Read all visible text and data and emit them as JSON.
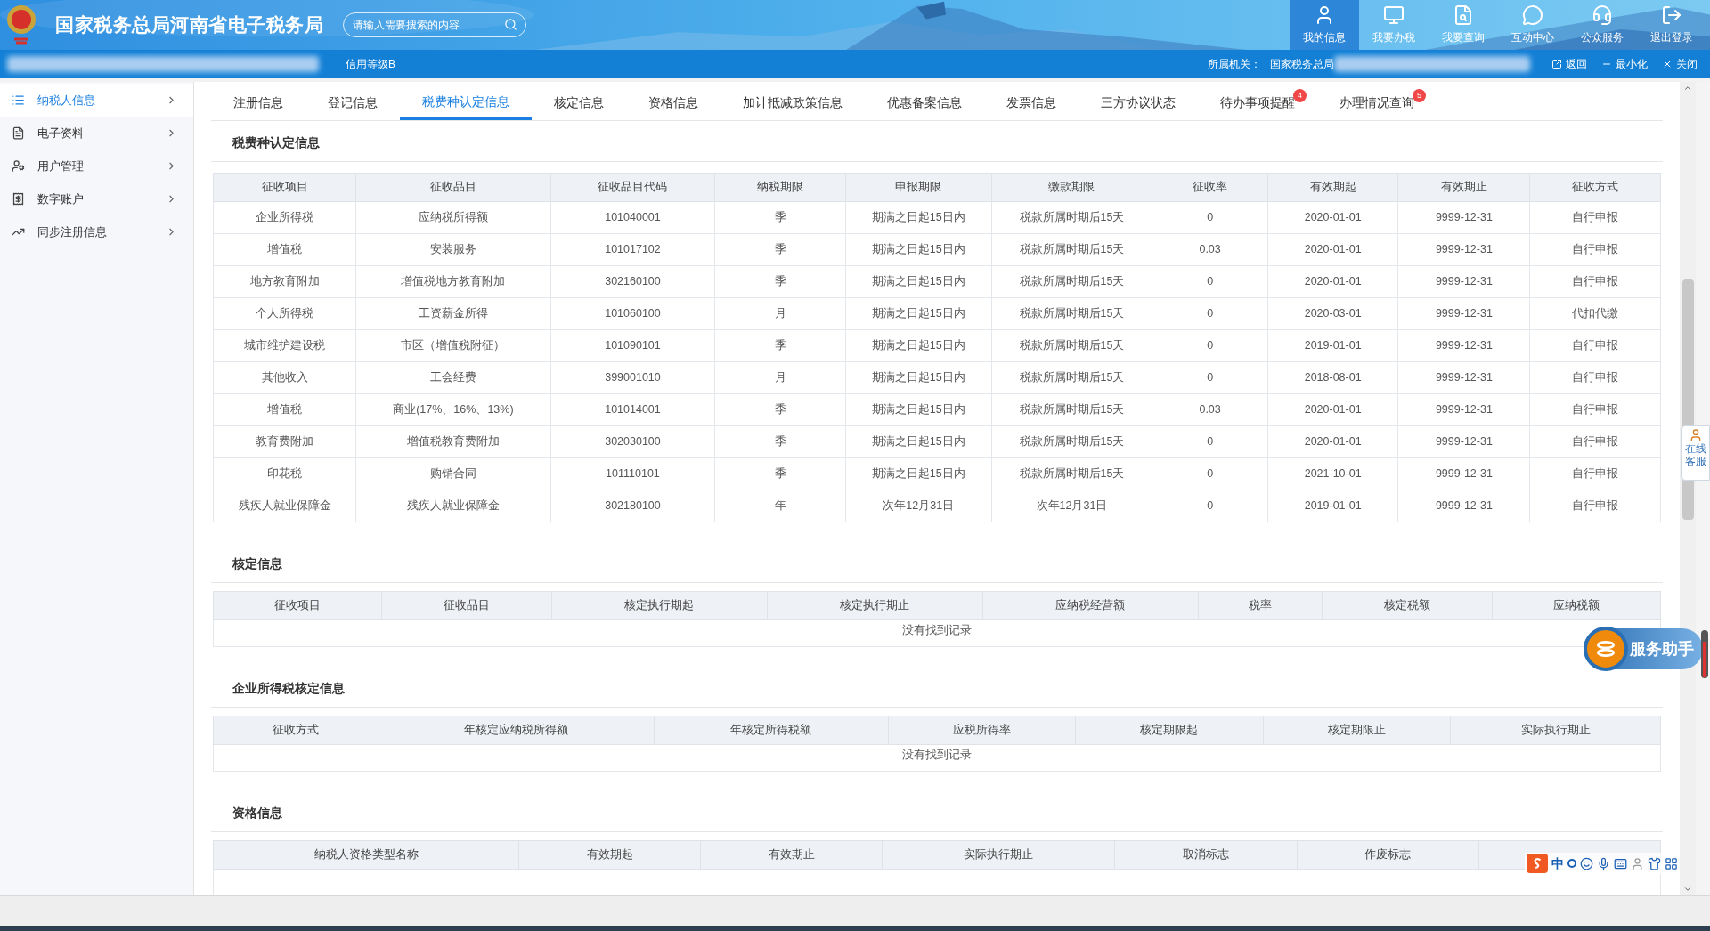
{
  "header": {
    "title": "国家税务总局河南省电子税务局",
    "search": {
      "placeholder": "请输入需要搜索的内容"
    },
    "nav": [
      {
        "label": "我的信息",
        "selected": true
      },
      {
        "label": "我要办税",
        "selected": false
      },
      {
        "label": "我要查询",
        "selected": false
      },
      {
        "label": "互动中心",
        "selected": false
      },
      {
        "label": "公众服务",
        "selected": false
      },
      {
        "label": "退出登录",
        "selected": false
      }
    ]
  },
  "sub_bar": {
    "credit": "信用等级B",
    "authority_label": "所属机关：",
    "authority": "国家税务总局",
    "actions": [
      "返回",
      "最小化",
      "关闭"
    ]
  },
  "sidebar": {
    "items": [
      {
        "label": "纳税人信息",
        "selected": true
      },
      {
        "label": "电子资料",
        "selected": false
      },
      {
        "label": "用户管理",
        "selected": false
      },
      {
        "label": "数字账户",
        "selected": false
      },
      {
        "label": "同步注册信息",
        "selected": false
      }
    ]
  },
  "tabs": [
    {
      "label": "注册信息",
      "selected": false
    },
    {
      "label": "登记信息",
      "selected": false
    },
    {
      "label": "税费种认定信息",
      "selected": true
    },
    {
      "label": "核定信息",
      "selected": false
    },
    {
      "label": "资格信息",
      "selected": false
    },
    {
      "label": "加计抵减政策信息",
      "selected": false
    },
    {
      "label": "优惠备案信息",
      "selected": false
    },
    {
      "label": "发票信息",
      "selected": false
    },
    {
      "label": "三方协议状态",
      "selected": false
    },
    {
      "label": "待办事项提醒",
      "selected": false,
      "badge": "4"
    },
    {
      "label": "办理情况查询",
      "selected": false,
      "badge": "5"
    }
  ],
  "sections": [
    {
      "title": "税费种认定信息",
      "columns": [
        "征收项目",
        "征收品目",
        "征收品目代码",
        "纳税期限",
        "申报期限",
        "缴款期限",
        "征收率",
        "有效期起",
        "有效期止",
        "征收方式"
      ],
      "rows": [
        [
          "企业所得税",
          "应纳税所得额",
          "101040001",
          "季",
          "期满之日起15日内",
          "税款所属时期后15天",
          "0",
          "2020-01-01",
          "9999-12-31",
          "自行申报"
        ],
        [
          "增值税",
          "安装服务",
          "101017102",
          "季",
          "期满之日起15日内",
          "税款所属时期后15天",
          "0.03",
          "2020-01-01",
          "9999-12-31",
          "自行申报"
        ],
        [
          "地方教育附加",
          "增值税地方教育附加",
          "302160100",
          "季",
          "期满之日起15日内",
          "税款所属时期后15天",
          "0",
          "2020-01-01",
          "9999-12-31",
          "自行申报"
        ],
        [
          "个人所得税",
          "工资薪金所得",
          "101060100",
          "月",
          "期满之日起15日内",
          "税款所属时期后15天",
          "0",
          "2020-03-01",
          "9999-12-31",
          "代扣代缴"
        ],
        [
          "城市维护建设税",
          "市区（增值税附征）",
          "101090101",
          "季",
          "期满之日起15日内",
          "税款所属时期后15天",
          "0",
          "2019-01-01",
          "9999-12-31",
          "自行申报"
        ],
        [
          "其他收入",
          "工会经费",
          "399001010",
          "月",
          "期满之日起15日内",
          "税款所属时期后15天",
          "0",
          "2018-08-01",
          "9999-12-31",
          "自行申报"
        ],
        [
          "增值税",
          "商业(17%、16%、13%)",
          "101014001",
          "季",
          "期满之日起15日内",
          "税款所属时期后15天",
          "0.03",
          "2020-01-01",
          "9999-12-31",
          "自行申报"
        ],
        [
          "教育费附加",
          "增值税教育费附加",
          "302030100",
          "季",
          "期满之日起15日内",
          "税款所属时期后15天",
          "0",
          "2020-01-01",
          "9999-12-31",
          "自行申报"
        ],
        [
          "印花税",
          "购销合同",
          "101110101",
          "季",
          "期满之日起15日内",
          "税款所属时期后15天",
          "0",
          "2021-10-01",
          "9999-12-31",
          "自行申报"
        ],
        [
          "残疾人就业保障金",
          "残疾人就业保障金",
          "302180100",
          "年",
          "次年12月31日",
          "次年12月31日",
          "0",
          "2019-01-01",
          "9999-12-31",
          "自行申报"
        ]
      ]
    },
    {
      "title": "核定信息",
      "columns": [
        "征收项目",
        "征收品目",
        "核定执行期起",
        "核定执行期止",
        "应纳税经营额",
        "税率",
        "核定税额",
        "应纳税额"
      ],
      "empty_text": "没有找到记录"
    },
    {
      "title": "企业所得税核定信息",
      "columns": [
        "征收方式",
        "年核定应纳税所得额",
        "年核定所得税额",
        "应税所得率",
        "核定期限起",
        "核定期限止",
        "实际执行期止"
      ],
      "empty_text": "没有找到记录"
    },
    {
      "title": "资格信息",
      "columns": [
        "纳税人资格类型名称",
        "有效期起",
        "有效期止",
        "实际执行期止",
        "取消标志",
        "作废标志"
      ]
    }
  ],
  "float": {
    "online_service": [
      "在线",
      "客服"
    ],
    "assistant": "服务助手"
  },
  "ime": {
    "mode": "中"
  }
}
